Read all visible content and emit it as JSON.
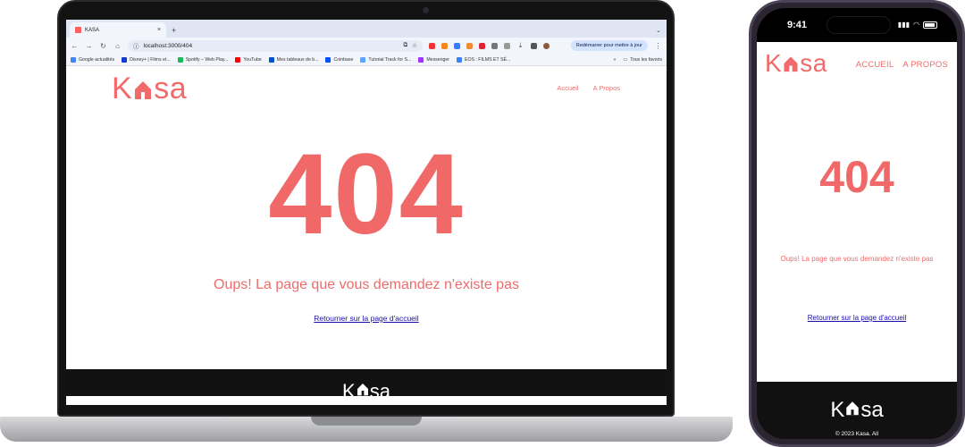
{
  "browser": {
    "tab_title": "KASA",
    "tab_close": "×",
    "new_tab": "+",
    "tab_menu": "⌄",
    "url": "localhost:3000/404",
    "restart_label": "Redémarrer pour mettre à jour",
    "bookmarks": [
      {
        "label": "Google actualités",
        "color": "#4285f4"
      },
      {
        "label": "Disney+ | Films et...",
        "color": "#113ccf"
      },
      {
        "label": "Spotify – Web Play...",
        "color": "#1db954"
      },
      {
        "label": "YouTube",
        "color": "#ff0000"
      },
      {
        "label": "Mes tableaux de b...",
        "color": "#0052cc"
      },
      {
        "label": "Coinbase",
        "color": "#0052ff"
      },
      {
        "label": "Tutorial Track for S...",
        "color": "#58a6ff"
      },
      {
        "label": "Messenger",
        "color": "#a033ff"
      },
      {
        "label": "EOS : FILMS ET SÉ...",
        "color": "#3b82f6"
      }
    ],
    "bookmarks_more": "»",
    "all_bookmarks": "Tous les favoris"
  },
  "site": {
    "brand_left": "K",
    "brand_right": "sa",
    "nav_desktop": [
      "Accueil",
      "A Propos"
    ],
    "nav_mobile": [
      "ACCUEIL",
      "A PROPOS"
    ],
    "error_code": "404",
    "error_message": "Oups! La page que vous demandez n'existe pas",
    "home_link": "Retourner sur la page d'accueil",
    "copyright": "© 2023 Kasa. All"
  },
  "phone": {
    "time": "9:41",
    "signal": "▮▮▮",
    "wifi": "◠"
  },
  "colors": {
    "brand": "#f26a6a",
    "footer": "#111111",
    "link": "#1a0dab"
  }
}
